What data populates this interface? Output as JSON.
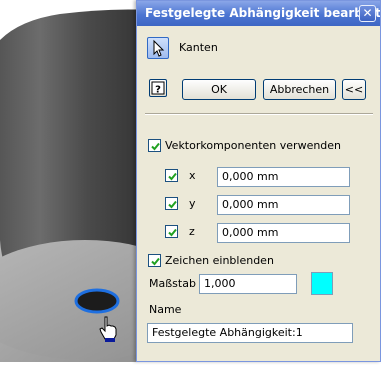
{
  "dialog": {
    "title": "Festgelegte Abhängigkeit bearbeiten",
    "close_glyph": "✕",
    "selection": {
      "icon": "cursor-arrow-icon",
      "label": "Kanten"
    },
    "buttons": {
      "help_icon": "question-mark-icon",
      "ok": "OK",
      "cancel": "Abbrechen",
      "collapse": "<<"
    },
    "vector": {
      "checkbox_label": "Vektorkomponenten verwenden",
      "checked": true,
      "components": [
        {
          "axis": "x",
          "value": "0,000 mm",
          "checked": true
        },
        {
          "axis": "y",
          "value": "0,000 mm",
          "checked": true
        },
        {
          "axis": "z",
          "value": "0,000 mm",
          "checked": true
        }
      ]
    },
    "display": {
      "checkbox_label": "Zeichen einblenden",
      "checked": true,
      "scale_label": "Maßstab",
      "scale_value": "1,000",
      "color": "#00ffff"
    },
    "name": {
      "label": "Name",
      "value": "Festgelegte Abhängigkeit:1"
    }
  },
  "viewport": {
    "object": "cylinder",
    "hole_highlight_color": "#1e6fe0",
    "cursor": "hand-pointer-icon"
  }
}
